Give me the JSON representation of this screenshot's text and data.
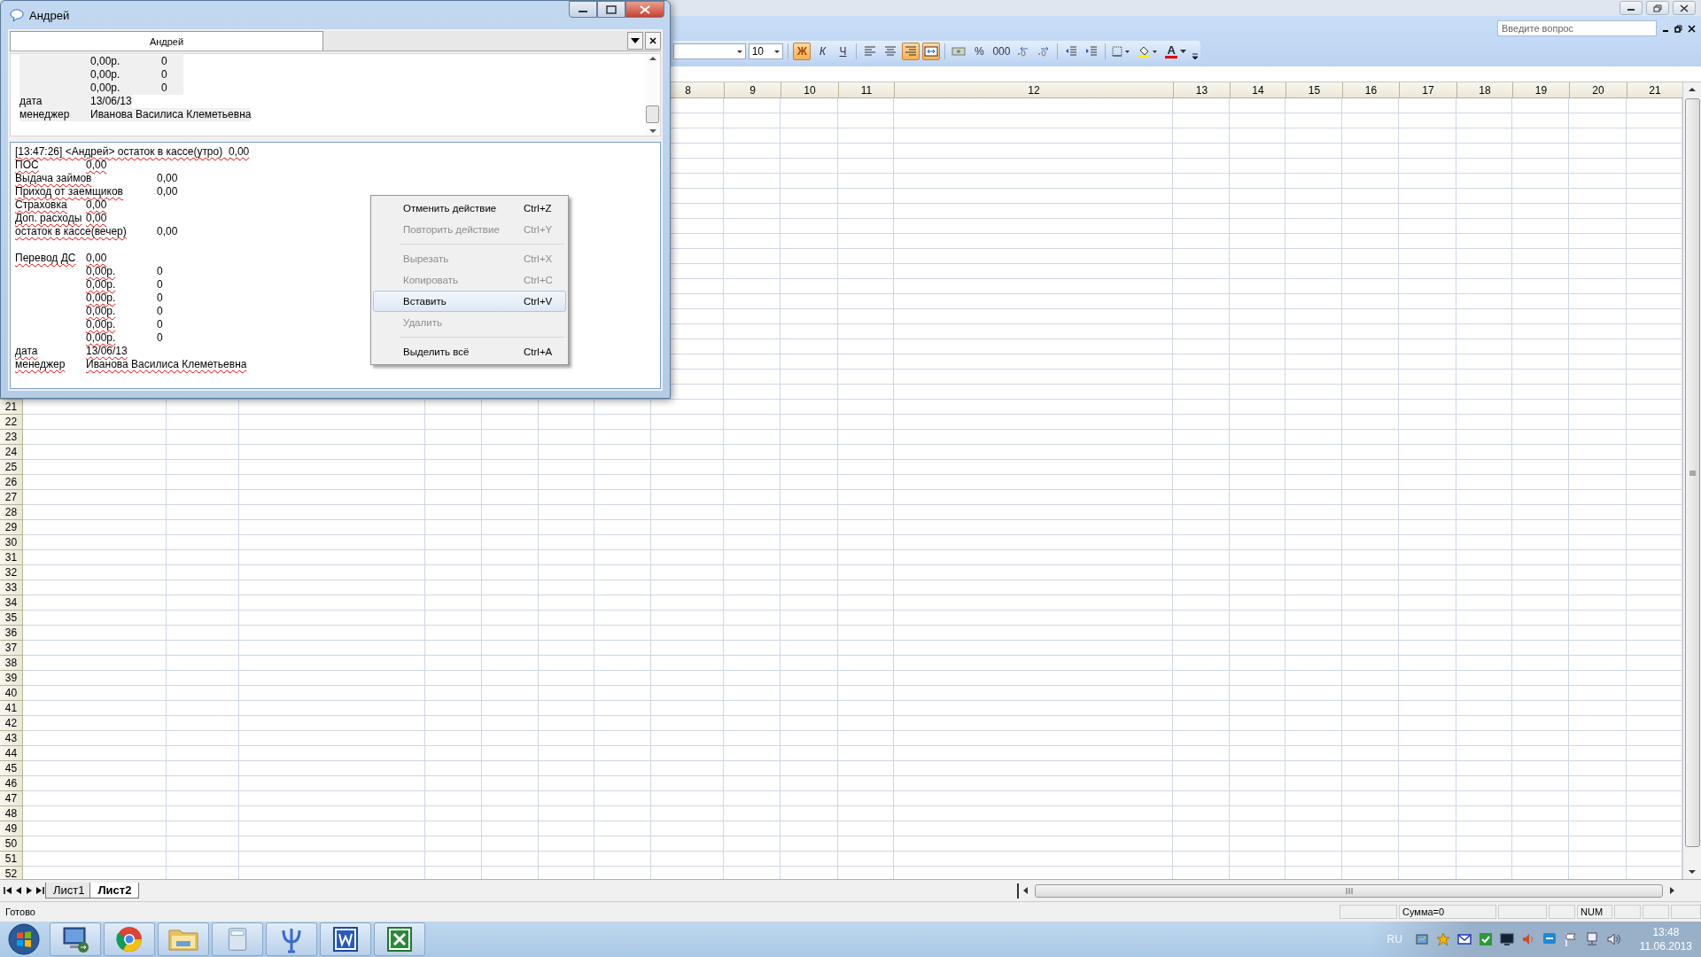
{
  "excel": {
    "help_search": {
      "placeholder": "Введите вопрос"
    },
    "toolbar": {
      "font_size": "10",
      "buttons": [
        {
          "kind": "bold",
          "label": "Ж",
          "on": true
        },
        {
          "kind": "italic",
          "label": "К",
          "on": false
        },
        {
          "kind": "underline",
          "label": "Ч",
          "on": false
        },
        {
          "kind": "align-left",
          "on": false
        },
        {
          "kind": "align-center",
          "on": false
        },
        {
          "kind": "align-right",
          "on": true
        },
        {
          "kind": "merge",
          "on": true
        },
        {
          "kind": "currency",
          "on": false
        },
        {
          "kind": "percent",
          "label": "%",
          "on": false
        },
        {
          "kind": "thousands",
          "label": "000",
          "on": false
        },
        {
          "kind": "inc-decimal",
          "on": false
        },
        {
          "kind": "dec-decimal",
          "on": false
        },
        {
          "kind": "outdent",
          "on": false
        },
        {
          "kind": "indent",
          "on": false
        },
        {
          "kind": "borders",
          "on": false
        },
        {
          "kind": "fill-color",
          "on": false
        },
        {
          "kind": "font-color",
          "label": "A",
          "on": false
        }
      ]
    },
    "column_headers": [
      "8",
      "9",
      "10",
      "11",
      "12",
      "13",
      "14",
      "15",
      "16",
      "17",
      "18",
      "19",
      "20",
      "21"
    ],
    "row_numbers": [
      "21",
      "22",
      "23",
      "24",
      "25",
      "26",
      "27",
      "28",
      "29",
      "30",
      "31",
      "32",
      "33",
      "34",
      "35",
      "36",
      "37",
      "38",
      "39",
      "40",
      "41",
      "42",
      "43",
      "44",
      "45",
      "46",
      "47",
      "48",
      "49",
      "50",
      "51",
      "52"
    ],
    "sheet_tabs": [
      {
        "label": "Лист1",
        "selected": false
      },
      {
        "label": "Лист2",
        "selected": true
      }
    ],
    "status_bar": {
      "text": "Готово",
      "sum": "Сумма=0",
      "num": "NUM"
    }
  },
  "chat_window": {
    "title": "Андрей",
    "tabs": [
      {
        "label": "Андрей",
        "selected": true
      }
    ],
    "history": [
      {
        "col_2": "0,00р.",
        "col_3": "0"
      },
      {
        "col_2": "0,00р.",
        "col_3": "0"
      },
      {
        "col_2": "0,00р.",
        "col_3": "0"
      },
      {
        "label": "дата",
        "col_2": "13/06/13"
      },
      {
        "label": "менеджер",
        "col_2": "Иванова Василиса Клеметьевна"
      }
    ],
    "message": {
      "header": "[13:47:26] <Андрей> остаток в кассе(утро)  0,00",
      "rows": [
        {
          "kind": "text",
          "label": "ПОС",
          "col_2": "0,00"
        },
        {
          "kind": "text",
          "label": "Выдача займов",
          "col_3": "0,00"
        },
        {
          "kind": "text",
          "label": "Приход от заемщиков",
          "col_3": "0,00"
        },
        {
          "kind": "text",
          "label": "Страховка",
          "col_2": "0,00"
        },
        {
          "kind": "text",
          "label": "Доп. расходы",
          "col_2": "0,00"
        },
        {
          "kind": "text",
          "label": "остаток в кассе(вечер)",
          "col_3": "0,00"
        },
        {
          "kind": "blank"
        },
        {
          "kind": "text",
          "label": "Перевод ДС",
          "col_2": "0,00"
        },
        {
          "kind": "text",
          "col_2": "0,00р.",
          "col_3": "0"
        },
        {
          "kind": "text",
          "col_2": "0,00р.",
          "col_3": "0"
        },
        {
          "kind": "text",
          "col_2": "0,00р.",
          "col_3": "0"
        },
        {
          "kind": "text",
          "col_2": "0,00р.",
          "col_3": "0"
        },
        {
          "kind": "text",
          "col_2": "0,00р.",
          "col_3": "0"
        },
        {
          "kind": "text",
          "col_2": "0,00р.",
          "col_3": "0"
        },
        {
          "kind": "text",
          "label": "дата",
          "col_2": "13/06/13"
        },
        {
          "kind": "text",
          "label": "менеджер",
          "col_2": "Иванова Василиса Клеметьевна"
        }
      ]
    }
  },
  "context_menu": {
    "items": [
      {
        "kind": "command",
        "label": "Отменить действие",
        "shortcut": "Ctrl+Z",
        "disabled": false,
        "selected": false
      },
      {
        "kind": "command",
        "label": "Повторить действие",
        "shortcut": "Ctrl+Y",
        "disabled": true,
        "selected": false
      },
      {
        "kind": "separator"
      },
      {
        "kind": "command",
        "label": "Вырезать",
        "shortcut": "Ctrl+X",
        "disabled": true,
        "selected": false
      },
      {
        "kind": "command",
        "label": "Копировать",
        "shortcut": "Ctrl+C",
        "disabled": true,
        "selected": false
      },
      {
        "kind": "command",
        "label": "Вставить",
        "shortcut": "Ctrl+V",
        "disabled": false,
        "selected": true
      },
      {
        "kind": "command",
        "label": "Удалить",
        "disabled": true,
        "selected": false
      },
      {
        "kind": "separator"
      },
      {
        "kind": "command",
        "label": "Выделить всё",
        "shortcut": "Ctrl+A",
        "disabled": false,
        "selected": false
      }
    ]
  },
  "taskbar": {
    "apps": [
      {
        "kind": "remote-desktop"
      },
      {
        "kind": "browser"
      },
      {
        "kind": "folder"
      },
      {
        "kind": "calculator"
      },
      {
        "kind": "psi"
      },
      {
        "kind": "word"
      },
      {
        "kind": "excel"
      }
    ],
    "language": "RU",
    "time": "13:48",
    "date": "11.06.2013"
  }
}
